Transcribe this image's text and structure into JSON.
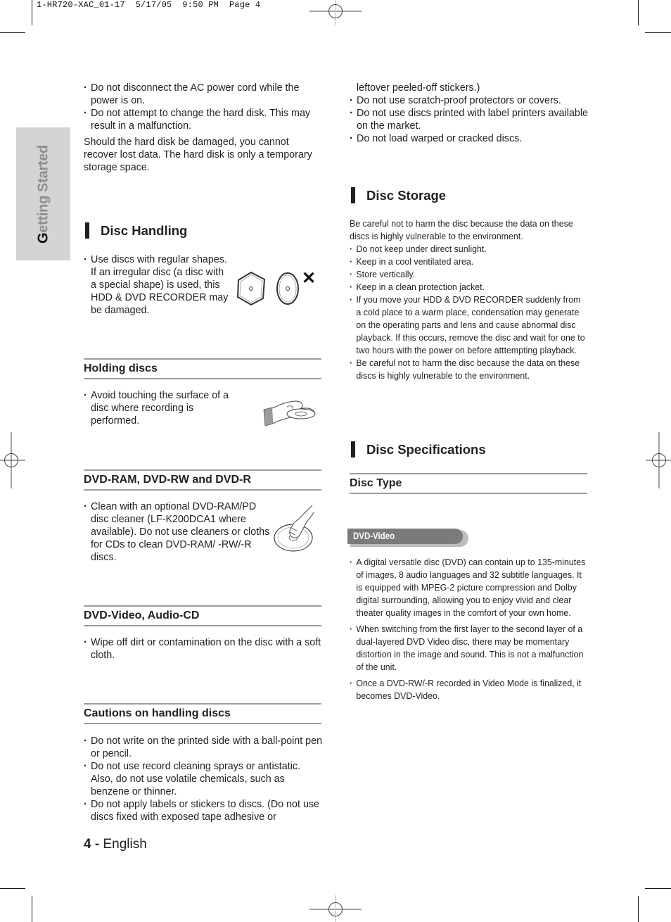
{
  "print_header": {
    "job_name": "1-HR720-XAC_01-17",
    "date": "5/17/05",
    "time": "9:50 PM",
    "page_label": "Page 4"
  },
  "side_tab": {
    "first_letter": "G",
    "rest": "etting Started"
  },
  "left_column": {
    "intro_bullets": [
      "Do not disconnect the AC power cord while the power is on.",
      "Do not attempt to change the hard disk. This may result in a malfunction."
    ],
    "intro_paragraph": "Should the hard disk be damaged, you cannot recover lost data. The hard disk is only a temporary storage space.",
    "disc_handling": {
      "title": "Disc Handling",
      "bullets": [
        "Use discs with regular shapes. If an irregular disc (a disc with a special shape) is used, this HDD & DVD RECORDER may be damaged."
      ],
      "illustration_mark": "✕"
    },
    "holding_discs": {
      "title": "Holding discs",
      "bullets": [
        "Avoid touching the surface of a disc where recording is performed."
      ]
    },
    "dvd_ram": {
      "title": "DVD-RAM, DVD-RW and DVD-R",
      "bullets": [
        "Clean with an optional DVD-RAM/PD disc cleaner (LF-K200DCA1 where available). Do not use cleaners or cloths for CDs to clean DVD-RAM/ -RW/-R discs."
      ]
    },
    "dvd_video_audio": {
      "title": "DVD-Video, Audio-CD",
      "bullets": [
        "Wipe off dirt or contamination on the disc with a soft cloth."
      ]
    },
    "cautions": {
      "title": "Cautions on handling discs",
      "bullets": [
        "Do not write on the printed side with a ball-point pen or pencil.",
        "Do not use record cleaning sprays or antistatic. Also, do not use volatile chemicals, such as benzene or thinner.",
        "Do not apply labels or stickers to discs. (Do not use discs fixed with exposed tape adhesive or"
      ]
    }
  },
  "right_column": {
    "cautions_continued": {
      "continuation": "leftover peeled-off stickers.)",
      "bullets": [
        "Do not use scratch-proof protectors or covers.",
        "Do not use discs printed with label printers available on the market.",
        "Do not load warped or cracked discs."
      ]
    },
    "disc_storage": {
      "title": "Disc Storage",
      "intro": "Be careful not to harm the disc because the data on these discs is highly vulnerable to the environment.",
      "bullets": [
        "Do not keep under direct sunlight.",
        "Keep in a cool ventilated area.",
        "Store vertically.",
        "Keep in a clean protection jacket.",
        "If you move your HDD & DVD RECORDER suddenly from a cold place to a warm place, condensation may generate on the operating parts and lens and cause abnormal disc playback. If this occurs, remove the disc and wait for one to two hours with the power on before atttempting playback.",
        "Be careful not to harm the disc because the data on these discs is highly vulnerable to the environment."
      ]
    },
    "disc_specifications": {
      "title": "Disc Specifications",
      "subtitle": "Disc Type",
      "badge": "DVD-Video",
      "bullets": [
        "A digital versatile disc (DVD) can contain up to 135-minutes of images, 8 audio languages and 32 subtitle languages. It is equipped with MPEG-2 picture compression and Dolby digital surrounding, allowing you to enjoy vivid and clear theater quality images in the comfort of your own home.",
        "When switching from the first layer to the second layer of a dual-layered DVD Video disc, there may be momentary distortion in the image and sound. This is not a malfunction of the unit.",
        "Once a DVD-RW/-R recorded in Video Mode is finalized, it becomes DVD-Video."
      ]
    }
  },
  "footer": {
    "page_number": "4 -",
    "language": "English"
  }
}
